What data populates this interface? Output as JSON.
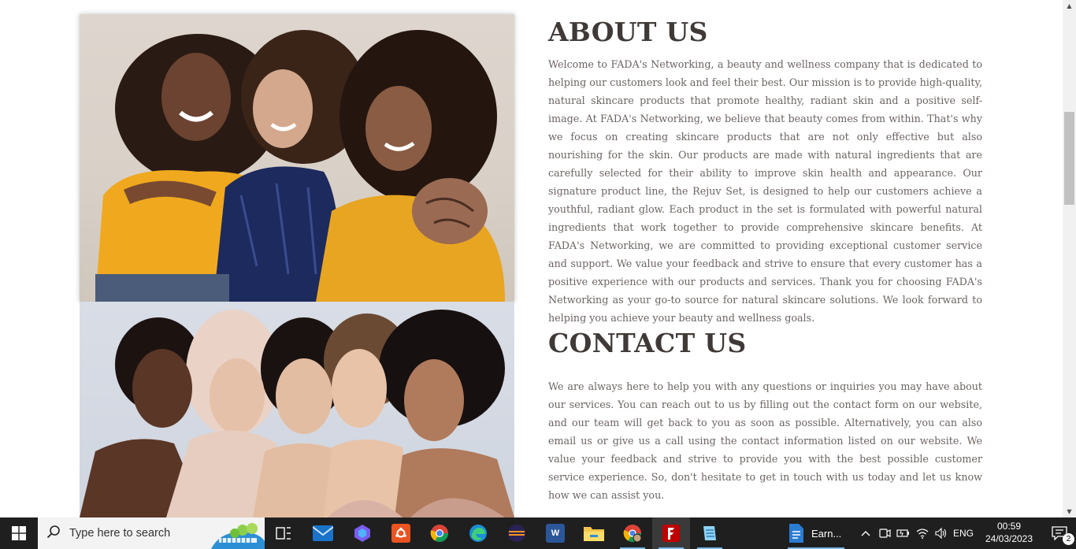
{
  "about": {
    "title": "ABOUT US",
    "body": "Welcome to FADA's Networking, a beauty and wellness company that is dedicated to helping our customers look and feel their best. Our mission is to provide high-quality, natural skincare products that promote healthy, radiant skin and a positive self-image. At FADA's Networking, we believe that beauty comes from within. That's why we focus on creating skincare products that are not only effective but also nourishing for the skin. Our products are made with natural ingredients that are carefully selected for their ability to improve skin health and appearance. Our signature product line, the Rejuv Set, is designed to help our customers achieve a youthful, radiant glow. Each product in the set is formulated with powerful natural ingredients that work together to provide comprehensive skincare benefits. At FADA's Networking, we are committed to providing exceptional customer service and support. We value your feedback and strive to ensure that every customer has a positive experience with our products and services. Thank you for choosing FADA's Networking as your go-to source for natural skincare solutions. We look forward to helping you achieve your beauty and wellness goals."
  },
  "contact": {
    "title": "CONTACT US",
    "body": "We are always here to help you with any questions or inquiries you may have about our services. You can reach out to us by filling out the contact form on our website, and our team will get back to you as soon as possible. Alternatively, you can also email us or give us a call using the contact information listed on our website. We value your feedback and strive to provide you with the best possible customer service experience. So, don't hesitate to get in touch with us today and let us know how we can assist you."
  },
  "taskbar": {
    "search_placeholder": "Type here to search",
    "running_app_label": "Earn...",
    "language": "ENG",
    "time": "00:59",
    "date": "24/03/2023",
    "notification_count": "2",
    "icons": [
      "windows-start-icon",
      "search-icon",
      "task-view-icon",
      "mail-icon",
      "copilot-icon",
      "ubuntu-icon",
      "chrome-icon",
      "edge-icon",
      "eclipse-icon",
      "word-icon",
      "file-explorer-icon",
      "chrome-profile-icon",
      "filezilla-icon",
      "notepad-icon",
      "word-document-icon"
    ]
  },
  "colors": {
    "heading": "#3f3a37",
    "body_text": "#6b6461",
    "taskbar": "#1f1f1f",
    "scrollbar_track": "#f1f1f1",
    "scrollbar_thumb": "#c1c1c1"
  }
}
